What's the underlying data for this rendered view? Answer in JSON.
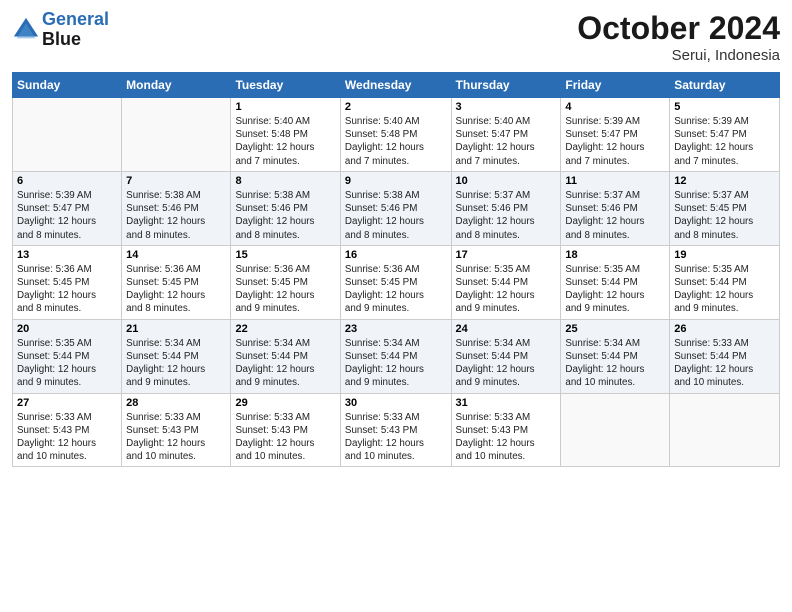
{
  "header": {
    "logo_line1": "General",
    "logo_line2": "Blue",
    "month": "October 2024",
    "location": "Serui, Indonesia"
  },
  "weekdays": [
    "Sunday",
    "Monday",
    "Tuesday",
    "Wednesday",
    "Thursday",
    "Friday",
    "Saturday"
  ],
  "weeks": [
    [
      {
        "day": "",
        "info": ""
      },
      {
        "day": "",
        "info": ""
      },
      {
        "day": "1",
        "info": "Sunrise: 5:40 AM\nSunset: 5:48 PM\nDaylight: 12 hours\nand 7 minutes."
      },
      {
        "day": "2",
        "info": "Sunrise: 5:40 AM\nSunset: 5:48 PM\nDaylight: 12 hours\nand 7 minutes."
      },
      {
        "day": "3",
        "info": "Sunrise: 5:40 AM\nSunset: 5:47 PM\nDaylight: 12 hours\nand 7 minutes."
      },
      {
        "day": "4",
        "info": "Sunrise: 5:39 AM\nSunset: 5:47 PM\nDaylight: 12 hours\nand 7 minutes."
      },
      {
        "day": "5",
        "info": "Sunrise: 5:39 AM\nSunset: 5:47 PM\nDaylight: 12 hours\nand 7 minutes."
      }
    ],
    [
      {
        "day": "6",
        "info": "Sunrise: 5:39 AM\nSunset: 5:47 PM\nDaylight: 12 hours\nand 8 minutes."
      },
      {
        "day": "7",
        "info": "Sunrise: 5:38 AM\nSunset: 5:46 PM\nDaylight: 12 hours\nand 8 minutes."
      },
      {
        "day": "8",
        "info": "Sunrise: 5:38 AM\nSunset: 5:46 PM\nDaylight: 12 hours\nand 8 minutes."
      },
      {
        "day": "9",
        "info": "Sunrise: 5:38 AM\nSunset: 5:46 PM\nDaylight: 12 hours\nand 8 minutes."
      },
      {
        "day": "10",
        "info": "Sunrise: 5:37 AM\nSunset: 5:46 PM\nDaylight: 12 hours\nand 8 minutes."
      },
      {
        "day": "11",
        "info": "Sunrise: 5:37 AM\nSunset: 5:46 PM\nDaylight: 12 hours\nand 8 minutes."
      },
      {
        "day": "12",
        "info": "Sunrise: 5:37 AM\nSunset: 5:45 PM\nDaylight: 12 hours\nand 8 minutes."
      }
    ],
    [
      {
        "day": "13",
        "info": "Sunrise: 5:36 AM\nSunset: 5:45 PM\nDaylight: 12 hours\nand 8 minutes."
      },
      {
        "day": "14",
        "info": "Sunrise: 5:36 AM\nSunset: 5:45 PM\nDaylight: 12 hours\nand 8 minutes."
      },
      {
        "day": "15",
        "info": "Sunrise: 5:36 AM\nSunset: 5:45 PM\nDaylight: 12 hours\nand 9 minutes."
      },
      {
        "day": "16",
        "info": "Sunrise: 5:36 AM\nSunset: 5:45 PM\nDaylight: 12 hours\nand 9 minutes."
      },
      {
        "day": "17",
        "info": "Sunrise: 5:35 AM\nSunset: 5:44 PM\nDaylight: 12 hours\nand 9 minutes."
      },
      {
        "day": "18",
        "info": "Sunrise: 5:35 AM\nSunset: 5:44 PM\nDaylight: 12 hours\nand 9 minutes."
      },
      {
        "day": "19",
        "info": "Sunrise: 5:35 AM\nSunset: 5:44 PM\nDaylight: 12 hours\nand 9 minutes."
      }
    ],
    [
      {
        "day": "20",
        "info": "Sunrise: 5:35 AM\nSunset: 5:44 PM\nDaylight: 12 hours\nand 9 minutes."
      },
      {
        "day": "21",
        "info": "Sunrise: 5:34 AM\nSunset: 5:44 PM\nDaylight: 12 hours\nand 9 minutes."
      },
      {
        "day": "22",
        "info": "Sunrise: 5:34 AM\nSunset: 5:44 PM\nDaylight: 12 hours\nand 9 minutes."
      },
      {
        "day": "23",
        "info": "Sunrise: 5:34 AM\nSunset: 5:44 PM\nDaylight: 12 hours\nand 9 minutes."
      },
      {
        "day": "24",
        "info": "Sunrise: 5:34 AM\nSunset: 5:44 PM\nDaylight: 12 hours\nand 9 minutes."
      },
      {
        "day": "25",
        "info": "Sunrise: 5:34 AM\nSunset: 5:44 PM\nDaylight: 12 hours\nand 10 minutes."
      },
      {
        "day": "26",
        "info": "Sunrise: 5:33 AM\nSunset: 5:44 PM\nDaylight: 12 hours\nand 10 minutes."
      }
    ],
    [
      {
        "day": "27",
        "info": "Sunrise: 5:33 AM\nSunset: 5:43 PM\nDaylight: 12 hours\nand 10 minutes."
      },
      {
        "day": "28",
        "info": "Sunrise: 5:33 AM\nSunset: 5:43 PM\nDaylight: 12 hours\nand 10 minutes."
      },
      {
        "day": "29",
        "info": "Sunrise: 5:33 AM\nSunset: 5:43 PM\nDaylight: 12 hours\nand 10 minutes."
      },
      {
        "day": "30",
        "info": "Sunrise: 5:33 AM\nSunset: 5:43 PM\nDaylight: 12 hours\nand 10 minutes."
      },
      {
        "day": "31",
        "info": "Sunrise: 5:33 AM\nSunset: 5:43 PM\nDaylight: 12 hours\nand 10 minutes."
      },
      {
        "day": "",
        "info": ""
      },
      {
        "day": "",
        "info": ""
      }
    ]
  ]
}
